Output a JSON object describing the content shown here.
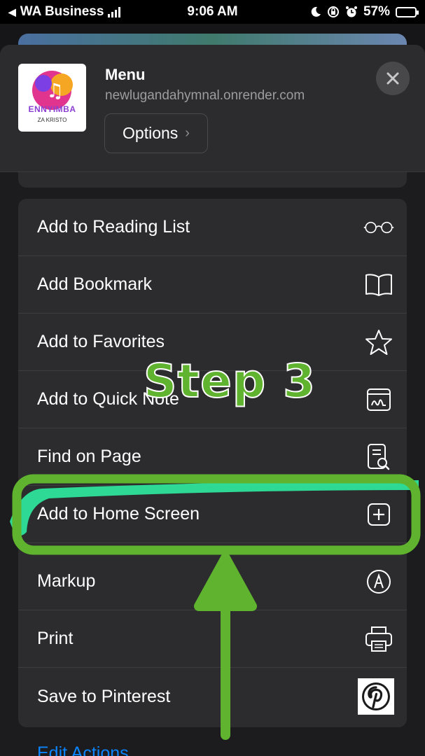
{
  "status_bar": {
    "carrier": "WA Business",
    "time": "9:06 AM",
    "battery_percent": "57%",
    "battery_level": 0.57,
    "battery_color": "#f5c518"
  },
  "header": {
    "title": "Menu",
    "url": "newlugandahymnal.onrender.com",
    "options_label": "Options",
    "app_icon_title": "ENNYIMBA",
    "app_icon_subtitle": "ZA KRISTO",
    "close_icon": "close-icon"
  },
  "actions": [
    {
      "label": "Add to Reading List",
      "icon": "glasses-icon"
    },
    {
      "label": "Add Bookmark",
      "icon": "book-icon"
    },
    {
      "label": "Add to Favorites",
      "icon": "star-icon"
    },
    {
      "label": "Add to Quick Note",
      "icon": "quick-note-icon"
    },
    {
      "label": "Find on Page",
      "icon": "find-on-page-icon"
    },
    {
      "label": "Add to Home Screen",
      "icon": "add-square-icon"
    },
    {
      "label": "Markup",
      "icon": "markup-icon"
    },
    {
      "label": "Print",
      "icon": "printer-icon"
    },
    {
      "label": "Save to Pinterest",
      "icon": "pinterest-icon"
    }
  ],
  "edit_actions_label": "Edit Actions...",
  "annotation": {
    "step_label": "Step 3",
    "highlight_color": "#5fb32e",
    "marker_color": "#2de39a"
  }
}
